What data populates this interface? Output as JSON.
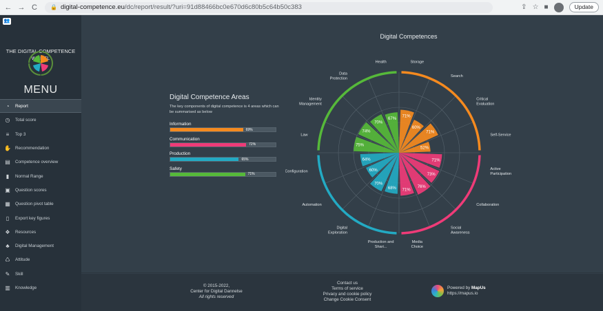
{
  "browser": {
    "url_host": "digital-competence.eu",
    "url_path": "/dc/report/result/?uri=91d88466bc0e670d6c80b5c64b50c383",
    "update_label": "Update"
  },
  "sidebar": {
    "logo_text_line1": "THE DIGITAL COMPETENCE",
    "logo_text_line2": "WHEEL",
    "menu_title": "MENU",
    "items": [
      {
        "label": "Report",
        "icon": "pie-chart-icon",
        "active": true
      },
      {
        "label": "Total score",
        "icon": "speedometer-icon"
      },
      {
        "label": "Top 3",
        "icon": "sliders-icon"
      },
      {
        "label": "Recommendation",
        "icon": "thumbs-icon"
      },
      {
        "label": "Competence overview",
        "icon": "area-chart-icon"
      },
      {
        "label": "Normal Range",
        "icon": "thermometer-icon"
      },
      {
        "label": "Question scores",
        "icon": "clipboard-icon"
      },
      {
        "label": "Question pivot table",
        "icon": "table-icon"
      },
      {
        "label": "Export key figures",
        "icon": "file-icon"
      },
      {
        "label": "Resources",
        "icon": "cubes-icon"
      },
      {
        "label": "Digital Management",
        "icon": "sitemap-icon"
      },
      {
        "label": "Attitude",
        "icon": "recycle-icon"
      },
      {
        "label": "Skill",
        "icon": "wrench-icon"
      },
      {
        "label": "Knowledge",
        "icon": "book-icon"
      }
    ]
  },
  "areas": {
    "title": "Digital Competence Areas",
    "subtitle": "The key components of digital competence is 4 areas which can be summarised as below",
    "items": [
      {
        "label": "Information",
        "value": 69,
        "value_label": "69%",
        "color": "#f58a1f"
      },
      {
        "label": "Communication",
        "value": 72,
        "value_label": "72%",
        "color": "#ef3b78"
      },
      {
        "label": "Production",
        "value": 65,
        "value_label": "65%",
        "color": "#23aac3"
      },
      {
        "label": "Safety",
        "value": 71,
        "value_label": "71%",
        "color": "#56b93a"
      }
    ]
  },
  "chart_data": {
    "type": "polar-bar",
    "title": "Digital Competences",
    "categories": [
      "Storage",
      "Search",
      "Critical Evaluation",
      "Self-Service",
      "Active Participation",
      "Collaboration",
      "Social Awareness",
      "Media Choice",
      "Production and Shari...",
      "Digital Exploration",
      "Automation",
      "Configuration",
      "Law",
      "Identity Management",
      "Data Protection",
      "Health"
    ],
    "values": [
      71,
      60,
      71,
      52,
      71,
      73,
      76,
      71,
      68,
      70,
      60,
      64,
      75,
      74,
      70,
      67
    ],
    "value_labels": [
      "71%",
      "60%",
      "71%",
      "52%",
      "71%",
      "73%",
      "76%",
      "71%",
      "68%",
      "70%",
      "60%",
      "64%",
      "75%",
      "74%",
      "70%",
      "67%"
    ],
    "area_colors": [
      "#f58a1f",
      "#f58a1f",
      "#f58a1f",
      "#f58a1f",
      "#ef3b78",
      "#ef3b78",
      "#ef3b78",
      "#ef3b78",
      "#23aac3",
      "#23aac3",
      "#23aac3",
      "#23aac3",
      "#56b93a",
      "#56b93a",
      "#56b93a",
      "#56b93a"
    ],
    "rlim": [
      0,
      100
    ]
  },
  "footer": {
    "copyright": "© 2015-2022,",
    "org": "Center for Digital Dannelse",
    "rights": "All rights reserved",
    "links": [
      "Contact us",
      "Terms of service",
      "Privacy and cookie policy",
      "Change Cookie Consent"
    ],
    "powered_prefix": "Powered by ",
    "powered_brand": "MapUs",
    "powered_url": "https://mapus.io"
  }
}
